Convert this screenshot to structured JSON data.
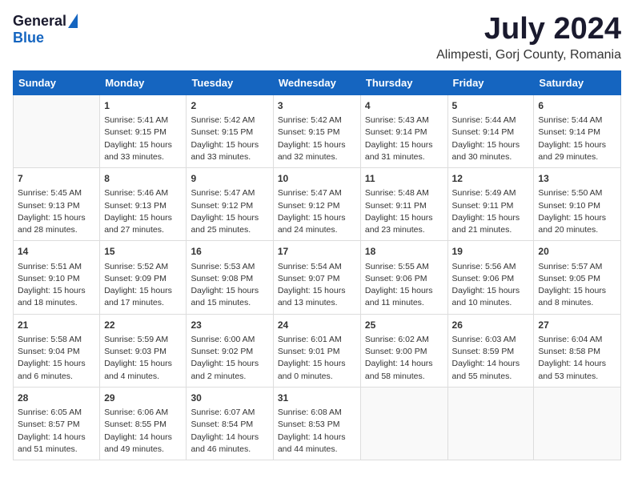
{
  "header": {
    "logo_general": "General",
    "logo_blue": "Blue",
    "month_year": "July 2024",
    "location": "Alimpesti, Gorj County, Romania"
  },
  "days_of_week": [
    "Sunday",
    "Monday",
    "Tuesday",
    "Wednesday",
    "Thursday",
    "Friday",
    "Saturday"
  ],
  "weeks": [
    [
      {
        "day": "",
        "content": ""
      },
      {
        "day": "1",
        "content": "Sunrise: 5:41 AM\nSunset: 9:15 PM\nDaylight: 15 hours\nand 33 minutes."
      },
      {
        "day": "2",
        "content": "Sunrise: 5:42 AM\nSunset: 9:15 PM\nDaylight: 15 hours\nand 33 minutes."
      },
      {
        "day": "3",
        "content": "Sunrise: 5:42 AM\nSunset: 9:15 PM\nDaylight: 15 hours\nand 32 minutes."
      },
      {
        "day": "4",
        "content": "Sunrise: 5:43 AM\nSunset: 9:14 PM\nDaylight: 15 hours\nand 31 minutes."
      },
      {
        "day": "5",
        "content": "Sunrise: 5:44 AM\nSunset: 9:14 PM\nDaylight: 15 hours\nand 30 minutes."
      },
      {
        "day": "6",
        "content": "Sunrise: 5:44 AM\nSunset: 9:14 PM\nDaylight: 15 hours\nand 29 minutes."
      }
    ],
    [
      {
        "day": "7",
        "content": "Sunrise: 5:45 AM\nSunset: 9:13 PM\nDaylight: 15 hours\nand 28 minutes."
      },
      {
        "day": "8",
        "content": "Sunrise: 5:46 AM\nSunset: 9:13 PM\nDaylight: 15 hours\nand 27 minutes."
      },
      {
        "day": "9",
        "content": "Sunrise: 5:47 AM\nSunset: 9:12 PM\nDaylight: 15 hours\nand 25 minutes."
      },
      {
        "day": "10",
        "content": "Sunrise: 5:47 AM\nSunset: 9:12 PM\nDaylight: 15 hours\nand 24 minutes."
      },
      {
        "day": "11",
        "content": "Sunrise: 5:48 AM\nSunset: 9:11 PM\nDaylight: 15 hours\nand 23 minutes."
      },
      {
        "day": "12",
        "content": "Sunrise: 5:49 AM\nSunset: 9:11 PM\nDaylight: 15 hours\nand 21 minutes."
      },
      {
        "day": "13",
        "content": "Sunrise: 5:50 AM\nSunset: 9:10 PM\nDaylight: 15 hours\nand 20 minutes."
      }
    ],
    [
      {
        "day": "14",
        "content": "Sunrise: 5:51 AM\nSunset: 9:10 PM\nDaylight: 15 hours\nand 18 minutes."
      },
      {
        "day": "15",
        "content": "Sunrise: 5:52 AM\nSunset: 9:09 PM\nDaylight: 15 hours\nand 17 minutes."
      },
      {
        "day": "16",
        "content": "Sunrise: 5:53 AM\nSunset: 9:08 PM\nDaylight: 15 hours\nand 15 minutes."
      },
      {
        "day": "17",
        "content": "Sunrise: 5:54 AM\nSunset: 9:07 PM\nDaylight: 15 hours\nand 13 minutes."
      },
      {
        "day": "18",
        "content": "Sunrise: 5:55 AM\nSunset: 9:06 PM\nDaylight: 15 hours\nand 11 minutes."
      },
      {
        "day": "19",
        "content": "Sunrise: 5:56 AM\nSunset: 9:06 PM\nDaylight: 15 hours\nand 10 minutes."
      },
      {
        "day": "20",
        "content": "Sunrise: 5:57 AM\nSunset: 9:05 PM\nDaylight: 15 hours\nand 8 minutes."
      }
    ],
    [
      {
        "day": "21",
        "content": "Sunrise: 5:58 AM\nSunset: 9:04 PM\nDaylight: 15 hours\nand 6 minutes."
      },
      {
        "day": "22",
        "content": "Sunrise: 5:59 AM\nSunset: 9:03 PM\nDaylight: 15 hours\nand 4 minutes."
      },
      {
        "day": "23",
        "content": "Sunrise: 6:00 AM\nSunset: 9:02 PM\nDaylight: 15 hours\nand 2 minutes."
      },
      {
        "day": "24",
        "content": "Sunrise: 6:01 AM\nSunset: 9:01 PM\nDaylight: 15 hours\nand 0 minutes."
      },
      {
        "day": "25",
        "content": "Sunrise: 6:02 AM\nSunset: 9:00 PM\nDaylight: 14 hours\nand 58 minutes."
      },
      {
        "day": "26",
        "content": "Sunrise: 6:03 AM\nSunset: 8:59 PM\nDaylight: 14 hours\nand 55 minutes."
      },
      {
        "day": "27",
        "content": "Sunrise: 6:04 AM\nSunset: 8:58 PM\nDaylight: 14 hours\nand 53 minutes."
      }
    ],
    [
      {
        "day": "28",
        "content": "Sunrise: 6:05 AM\nSunset: 8:57 PM\nDaylight: 14 hours\nand 51 minutes."
      },
      {
        "day": "29",
        "content": "Sunrise: 6:06 AM\nSunset: 8:55 PM\nDaylight: 14 hours\nand 49 minutes."
      },
      {
        "day": "30",
        "content": "Sunrise: 6:07 AM\nSunset: 8:54 PM\nDaylight: 14 hours\nand 46 minutes."
      },
      {
        "day": "31",
        "content": "Sunrise: 6:08 AM\nSunset: 8:53 PM\nDaylight: 14 hours\nand 44 minutes."
      },
      {
        "day": "",
        "content": ""
      },
      {
        "day": "",
        "content": ""
      },
      {
        "day": "",
        "content": ""
      }
    ]
  ]
}
